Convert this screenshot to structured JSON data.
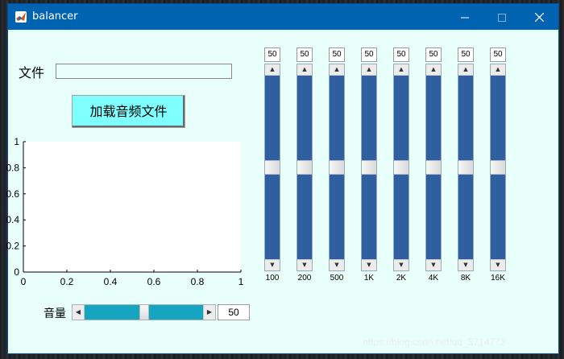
{
  "window": {
    "title": "balancer",
    "app_icon": "matlab-icon"
  },
  "controls": {
    "file_label": "文件",
    "file_path": "",
    "load_button": "加载音频文件",
    "volume_label": "音量",
    "volume_value": "50",
    "volume_level": 0.5
  },
  "equalizer": {
    "bands": [
      {
        "value": "50",
        "freq": "100",
        "level": 0.5
      },
      {
        "value": "50",
        "freq": "200",
        "level": 0.5
      },
      {
        "value": "50",
        "freq": "500",
        "level": 0.5
      },
      {
        "value": "50",
        "freq": "1K",
        "level": 0.5
      },
      {
        "value": "50",
        "freq": "2K",
        "level": 0.5
      },
      {
        "value": "50",
        "freq": "4K",
        "level": 0.5
      },
      {
        "value": "50",
        "freq": "8K",
        "level": 0.5
      },
      {
        "value": "50",
        "freq": "16K",
        "level": 0.5
      }
    ]
  },
  "axes": {
    "x_ticks": [
      "0",
      "0.2",
      "0.4",
      "0.6",
      "0.8",
      "1"
    ],
    "y_ticks": [
      "0",
      "0.2",
      "0.4",
      "0.6",
      "0.8",
      "1"
    ],
    "xlim": [
      0,
      1
    ],
    "ylim": [
      0,
      1
    ]
  },
  "watermark": "https://blog.csdn.net/qq_3714772",
  "colors": {
    "titlebar": "#0063b1",
    "window_bg": "#e9fffa",
    "load_button": "#80ffff",
    "eq_slider": "#2f5ea1",
    "volume_slider": "#15a5c1"
  }
}
